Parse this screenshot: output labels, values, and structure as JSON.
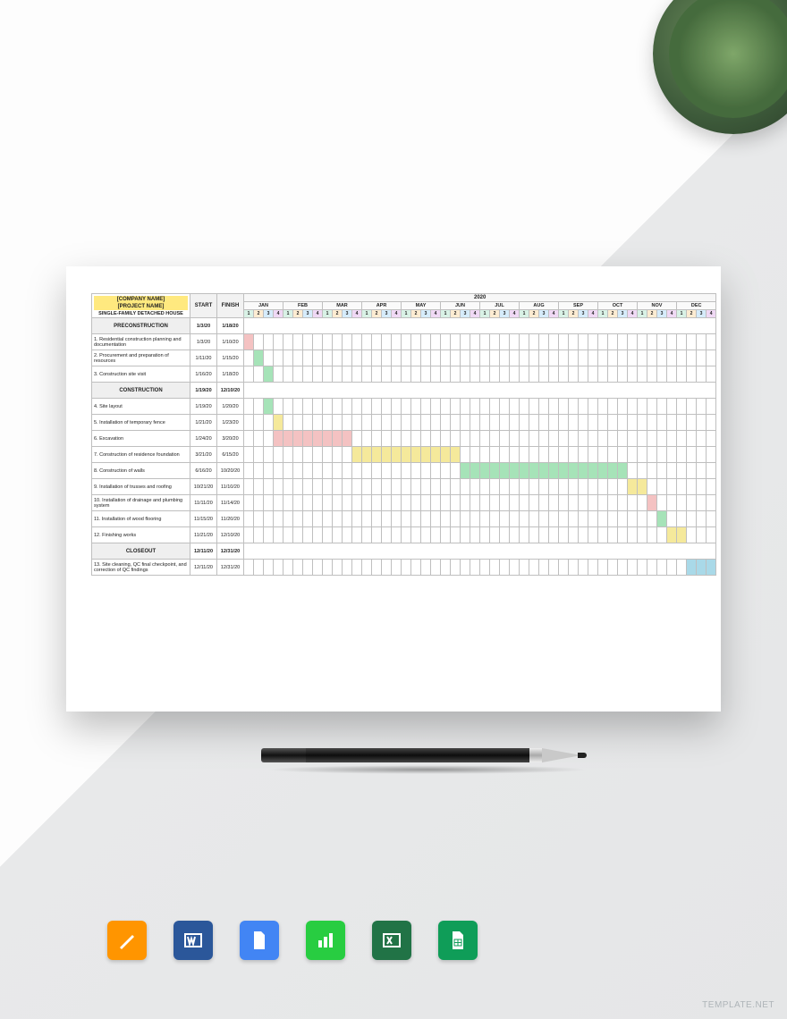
{
  "header": {
    "company": "[COMPANY NAME]",
    "project": "[PROJECT NAME]",
    "subtitle": "SINGLE-FAMILY DETACHED HOUSE",
    "start_label": "START",
    "finish_label": "FINISH",
    "year": "2020"
  },
  "months": [
    "JAN",
    "FEB",
    "MAR",
    "APR",
    "MAY",
    "JUN",
    "JUL",
    "AUG",
    "SEP",
    "OCT",
    "NOV",
    "DEC"
  ],
  "weeks": [
    "1",
    "2",
    "3",
    "4"
  ],
  "sections": [
    {
      "name": "PRECONSTRUCTION",
      "start": "1/3/20",
      "finish": "1/18/20",
      "tasks": [
        {
          "name": "1. Residential construction planning and documentation",
          "start": "1/3/20",
          "finish": "1/10/20",
          "bar": {
            "from": 0,
            "to": 1,
            "color": "b-pink"
          }
        },
        {
          "name": "2. Procurement and preparation of resources",
          "start": "1/11/20",
          "finish": "1/15/20",
          "bar": {
            "from": 1,
            "to": 2,
            "color": "b-grn"
          }
        },
        {
          "name": "3. Construction site visit",
          "start": "1/16/20",
          "finish": "1/18/20",
          "bar": {
            "from": 2,
            "to": 3,
            "color": "b-grn"
          }
        }
      ]
    },
    {
      "name": "CONSTRUCTION",
      "start": "1/19/20",
      "finish": "12/10/20",
      "tasks": [
        {
          "name": "4. Site layout",
          "start": "1/19/20",
          "finish": "1/20/20",
          "bar": {
            "from": 2,
            "to": 3,
            "color": "b-grn"
          }
        },
        {
          "name": "5. Installation of temporary fence",
          "start": "1/21/20",
          "finish": "1/23/20",
          "bar": {
            "from": 3,
            "to": 4,
            "color": "b-yel"
          }
        },
        {
          "name": "6. Excavation",
          "start": "1/24/20",
          "finish": "3/20/20",
          "bar": {
            "from": 3,
            "to": 11,
            "color": "b-pink"
          }
        },
        {
          "name": "7. Construction of residence foundation",
          "start": "3/21/20",
          "finish": "6/15/20",
          "bar": {
            "from": 11,
            "to": 22,
            "color": "b-yel"
          }
        },
        {
          "name": "8. Construction of walls",
          "start": "6/16/20",
          "finish": "10/20/20",
          "bar": {
            "from": 22,
            "to": 39,
            "color": "b-grn"
          }
        },
        {
          "name": "9. Installation of trusses and roofing",
          "start": "10/21/20",
          "finish": "11/10/20",
          "bar": {
            "from": 39,
            "to": 41,
            "color": "b-yel"
          }
        },
        {
          "name": "10. Installation of drainage and plumbing system",
          "start": "11/11/20",
          "finish": "11/14/20",
          "bar": {
            "from": 41,
            "to": 42,
            "color": "b-pink"
          }
        },
        {
          "name": "11. Installation of wood flooring",
          "start": "11/15/20",
          "finish": "11/20/20",
          "bar": {
            "from": 42,
            "to": 43,
            "color": "b-grn"
          }
        },
        {
          "name": "12. Finishing works",
          "start": "11/21/20",
          "finish": "12/10/20",
          "bar": {
            "from": 43,
            "to": 45,
            "color": "b-yel"
          }
        }
      ]
    },
    {
      "name": "CLOSEOUT",
      "start": "12/11/20",
      "finish": "12/31/20",
      "tasks": [
        {
          "name": "13. Site cleaning, QC final checkpoint, and correction of QC findings",
          "start": "12/11/20",
          "finish": "12/31/20",
          "bar": {
            "from": 45,
            "to": 48,
            "color": "b-blu"
          }
        }
      ]
    }
  ],
  "icons": [
    {
      "name": "pages-icon",
      "bg": "#ff9500"
    },
    {
      "name": "word-icon",
      "bg": "#2b579a"
    },
    {
      "name": "gdocs-icon",
      "bg": "#4285f4"
    },
    {
      "name": "numbers-icon",
      "bg": "#28cd41"
    },
    {
      "name": "excel-icon",
      "bg": "#217346"
    },
    {
      "name": "gsheets-icon",
      "bg": "#0f9d58"
    }
  ],
  "watermark": "TEMPLATE.NET",
  "chart_data": {
    "type": "gantt",
    "title": "Single-Family Detached House Construction Schedule 2020",
    "x_unit": "week",
    "x_range": [
      1,
      48
    ],
    "tasks": [
      {
        "name": "Residential construction planning and documentation",
        "start_week": 1,
        "end_week": 2
      },
      {
        "name": "Procurement and preparation of resources",
        "start_week": 2,
        "end_week": 3
      },
      {
        "name": "Construction site visit",
        "start_week": 3,
        "end_week": 3
      },
      {
        "name": "Site layout",
        "start_week": 3,
        "end_week": 3
      },
      {
        "name": "Installation of temporary fence",
        "start_week": 4,
        "end_week": 4
      },
      {
        "name": "Excavation",
        "start_week": 4,
        "end_week": 12
      },
      {
        "name": "Construction of residence foundation",
        "start_week": 12,
        "end_week": 23
      },
      {
        "name": "Construction of walls",
        "start_week": 23,
        "end_week": 40
      },
      {
        "name": "Installation of trusses and roofing",
        "start_week": 40,
        "end_week": 42
      },
      {
        "name": "Installation of drainage and plumbing system",
        "start_week": 42,
        "end_week": 43
      },
      {
        "name": "Installation of wood flooring",
        "start_week": 43,
        "end_week": 44
      },
      {
        "name": "Finishing works",
        "start_week": 44,
        "end_week": 46
      },
      {
        "name": "Site cleaning, QC final checkpoint, and correction of QC findings",
        "start_week": 46,
        "end_week": 48
      }
    ]
  }
}
